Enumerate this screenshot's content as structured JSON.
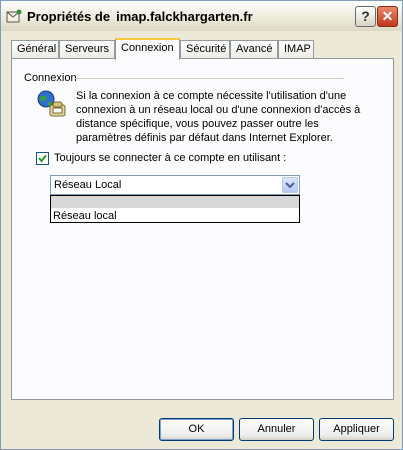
{
  "window": {
    "title_prefix": "Propriétés de",
    "title_host": "imap.falckhargarten.fr",
    "help_label": "?",
    "close_label": "✕"
  },
  "tabs": [
    {
      "label": "Général"
    },
    {
      "label": "Serveurs"
    },
    {
      "label": "Connexion"
    },
    {
      "label": "Sécurité"
    },
    {
      "label": "Avancé"
    },
    {
      "label": "IMAP"
    }
  ],
  "active_tab": "Connexion",
  "connection": {
    "group_label": "Connexion",
    "description": "Si la connexion à ce compte nécessite l'utilisation d'une connexion à un réseau local ou d'une connexion d'accès à distance spécifique, vous pouvez passer outre les paramètres définis par défaut dans Internet Explorer.",
    "always_connect_label": "Toujours se connecter à ce compte en utilisant :",
    "always_connect_checked": true,
    "selected_value": "Réseau Local",
    "dropdown_options": [
      "",
      "Réseau local"
    ]
  },
  "buttons": {
    "ok": "OK",
    "cancel": "Annuler",
    "apply": "Appliquer"
  },
  "colors": {
    "accent_tab": "#ffc83c",
    "window_bg": "#ece9d8",
    "close_red": "#c0391d"
  },
  "icons": {
    "title": "mail-server-icon",
    "connection": "network-globe-phone-icon"
  }
}
